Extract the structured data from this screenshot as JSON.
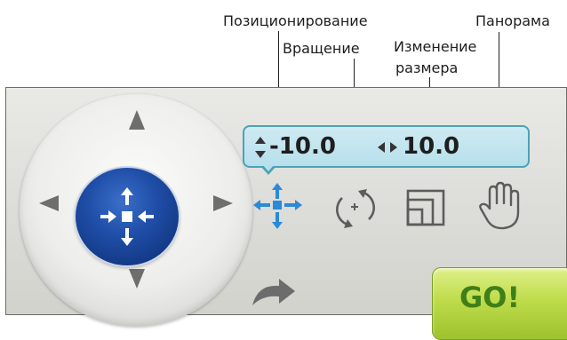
{
  "callouts": {
    "positioning": "Позиционирование",
    "rotation": "Вращение",
    "resize_line1": "Изменение",
    "resize_line2": "размера",
    "pan": "Панорама"
  },
  "readout": {
    "vertical_value": "-10.0",
    "horizontal_value": "10.0"
  },
  "go_button_label": "GO!",
  "colors": {
    "center_button_blue": "#1f4ea8",
    "readout_fill": "#b6e0ec",
    "readout_border": "#4aa3b8",
    "active_tool_blue": "#2a8ad8",
    "go_green": "#a9cd36"
  }
}
